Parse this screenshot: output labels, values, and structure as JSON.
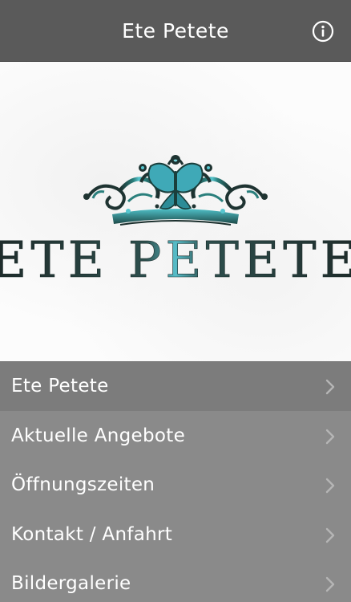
{
  "header": {
    "title": "Ete Petete",
    "info_icon": "info-circle-icon"
  },
  "banner": {
    "logo_text": "ETE PETETE",
    "colors": {
      "crown_dark": "#1f3a37",
      "crown_teal": "#2a8f8c",
      "butterfly": "#5fc3d6",
      "text_dark": "#2a3b3a",
      "text_teal": "#4ab3c0"
    }
  },
  "menu": {
    "items": [
      {
        "label": "Ete Petete",
        "icon": "chevron-right-icon"
      },
      {
        "label": "Aktuelle Angebote",
        "icon": "chevron-right-icon"
      },
      {
        "label": "Öffnungszeiten",
        "icon": "chevron-right-icon"
      },
      {
        "label": "Kontakt / Anfahrt",
        "icon": "chevron-right-icon"
      },
      {
        "label": "Bildergalerie",
        "icon": "chevron-right-icon"
      }
    ]
  },
  "colors": {
    "navbar": "#5a5a5a",
    "menu_bg": "#8a8a8a",
    "menu_first": "#7c7c7c",
    "text": "#ffffff",
    "chevron": "#b5b5b5"
  }
}
